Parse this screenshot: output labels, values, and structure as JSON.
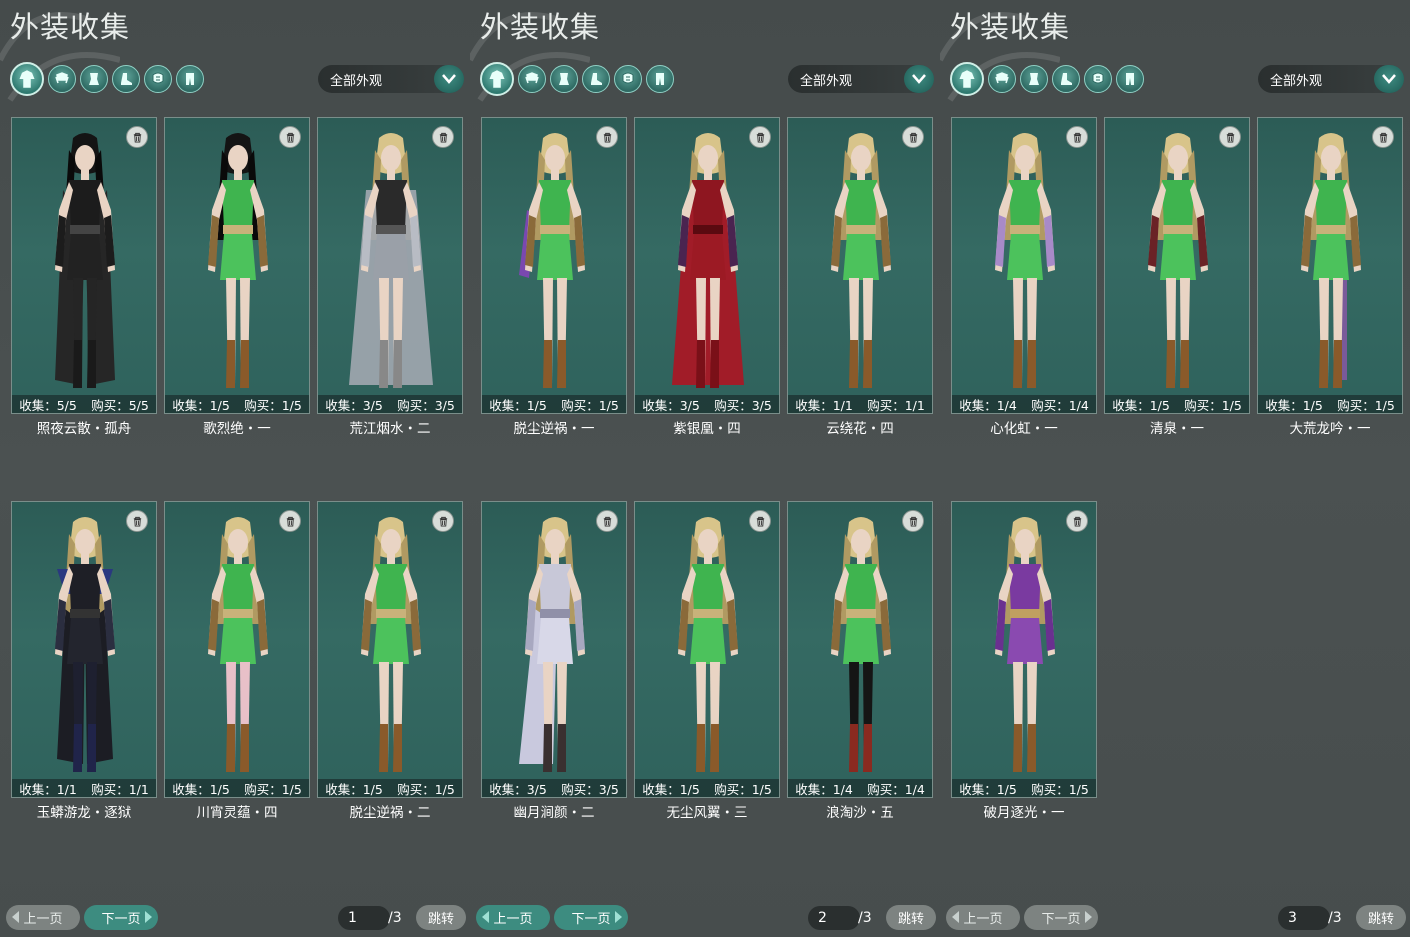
{
  "colors": {
    "card_bg": "#2f625c",
    "button_active": "#3d8c80",
    "button_inactive": "#7d8381",
    "panel_bg": "#4a5050"
  },
  "panels": [
    {
      "title": "外装收集",
      "filter": "全部外观",
      "cards": [
        {
          "stats_collect": "收集：5/5",
          "stats_buy": "购买：5/5",
          "name": "照夜云散・孤舟",
          "outfit": "black-coat",
          "skin": "dark-hair"
        },
        {
          "stats_collect": "收集：1/5",
          "stats_buy": "购买：1/5",
          "name": "歌烈绝・一",
          "outfit": "green-default",
          "skin": "dark-hair"
        },
        {
          "stats_collect": "收集：3/5",
          "stats_buy": "购买：3/5",
          "name": "荒江烟水・二",
          "outfit": "grey-robe",
          "skin": "blonde"
        },
        {
          "stats_collect": "收集：1/1",
          "stats_buy": "购买：1/1",
          "name": "玉蟒游龙・逐狱",
          "outfit": "black-armor",
          "skin": "blonde"
        },
        {
          "stats_collect": "收集：1/5",
          "stats_buy": "购买：1/5",
          "name": "川宵灵蕴・四",
          "outfit": "green-pink-legs",
          "skin": "blonde"
        },
        {
          "stats_collect": "收集：1/5",
          "stats_buy": "购买：1/5",
          "name": "脱尘逆祸・二",
          "outfit": "green-default",
          "skin": "blonde"
        }
      ],
      "prev": "上一页",
      "next": "下一页",
      "active_btn": "next",
      "page": "1",
      "total": "/3",
      "jump": "跳转"
    },
    {
      "title": "外装收集",
      "filter": "全部外观",
      "cards": [
        {
          "stats_collect": "收集：1/5",
          "stats_buy": "购买：1/5",
          "name": "脱尘逆祸・一",
          "outfit": "green-purple-sleeve",
          "skin": "blonde"
        },
        {
          "stats_collect": "收集：3/5",
          "stats_buy": "购买：3/5",
          "name": "紫银凰・四",
          "outfit": "red-gown",
          "skin": "blonde"
        },
        {
          "stats_collect": "收集：1/1",
          "stats_buy": "购买：1/1",
          "name": "云绕花・四",
          "outfit": "green-default",
          "skin": "blonde"
        },
        {
          "stats_collect": "收集：3/5",
          "stats_buy": "购买：3/5",
          "name": "幽月涧颜・二",
          "outfit": "white-gown",
          "skin": "blonde"
        },
        {
          "stats_collect": "收集：1/5",
          "stats_buy": "购买：1/5",
          "name": "无尘风翼・三",
          "outfit": "green-default",
          "skin": "blonde"
        },
        {
          "stats_collect": "收集：1/4",
          "stats_buy": "购买：1/4",
          "name": "浪淘沙・五",
          "outfit": "green-black-legs",
          "skin": "blonde"
        }
      ],
      "prev": "上一页",
      "next": "下一页",
      "active_btn": "both",
      "page": "2",
      "total": "/3",
      "jump": "跳转"
    },
    {
      "title": "外装收集",
      "filter": "全部外观",
      "cards": [
        {
          "stats_collect": "收集：1/4",
          "stats_buy": "购买：1/4",
          "name": "心化虹・一",
          "outfit": "green-lavender-sleeve",
          "skin": "blonde"
        },
        {
          "stats_collect": "收集：1/5",
          "stats_buy": "购买：1/5",
          "name": "清泉・一",
          "outfit": "green-red-sleeve",
          "skin": "blonde"
        },
        {
          "stats_collect": "收集：1/5",
          "stats_buy": "购买：1/5",
          "name": "大荒龙吟・一",
          "outfit": "green-purple-leg",
          "skin": "blonde"
        },
        {
          "stats_collect": "收集：1/5",
          "stats_buy": "购买：1/5",
          "name": "破月逐光・一",
          "outfit": "purple-armor",
          "skin": "blonde"
        }
      ],
      "prev": "上一页",
      "next": "下一页",
      "active_btn": "prev",
      "page": "3",
      "total": "/3",
      "jump": "跳转"
    }
  ]
}
